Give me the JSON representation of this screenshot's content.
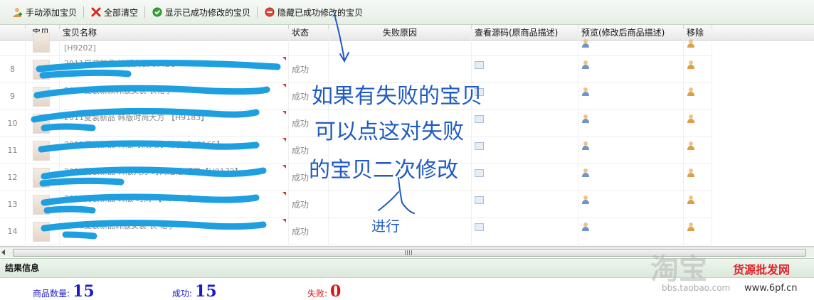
{
  "toolbar": {
    "add_manual": "手动添加宝贝",
    "clear_all": "全部清空",
    "show_success": "显示已成功修改的宝贝",
    "hide_success": "隐藏已成功修改的宝贝"
  },
  "table": {
    "headers": {
      "thumb": "宝贝",
      "name": "宝贝名称",
      "status": "状态",
      "reason": "失败原因",
      "source": "查看源码(原商品描述)",
      "preview": "预览(修改后商品描述)",
      "remove": "移除"
    },
    "rows": [
      {
        "no": "",
        "name": "[H9202]",
        "status": ""
      },
      {
        "no": "8",
        "name": "2011夏装新品 韩版女装 长 裙子",
        "status": "成功"
      },
      {
        "no": "9",
        "name": "2011夏装新款韩版女装 长裙子",
        "status": "成功"
      },
      {
        "no": "10",
        "name": "2011夏装新品 韩版时尚大方 【H9183】",
        "status": "成功"
      },
      {
        "no": "11",
        "name": "2011夏装新品 韩版时尚大方 裙子【H9165】",
        "status": "成功"
      },
      {
        "no": "12",
        "name": "2011夏装新品 韩版大方 时尚短袖 裙子【H9172】",
        "status": "成功"
      },
      {
        "no": "13",
        "name": "2011夏装新品 韩版 时尚 【H9160】",
        "status": "成功"
      },
      {
        "no": "14",
        "name": "2011夏装新品韩版女装 长 裙子",
        "status": "成功"
      }
    ]
  },
  "result": {
    "title": "结果信息",
    "count_label": "商品数量:",
    "count_value": "15",
    "success_label": "成功:",
    "success_value": "15",
    "fail_label": "失败:",
    "fail_value": "0"
  },
  "annotation": {
    "line1": "如果有失败的宝贝",
    "line2": "可以点这对失败",
    "line3": "的宝贝二次修改",
    "line4": "进行"
  },
  "watermark": {
    "brand": "淘宝",
    "site": "bbs.taobao.com",
    "logo_text": "货源批发网",
    "logo_url": "www.6pf.cn"
  },
  "colors": {
    "toolbar_bg": "#e6eee6",
    "scribble": "#1e9fe0",
    "annotation_ink": "#1f5bc2",
    "count_value": "#1a1acc",
    "fail_value": "#e01010"
  }
}
